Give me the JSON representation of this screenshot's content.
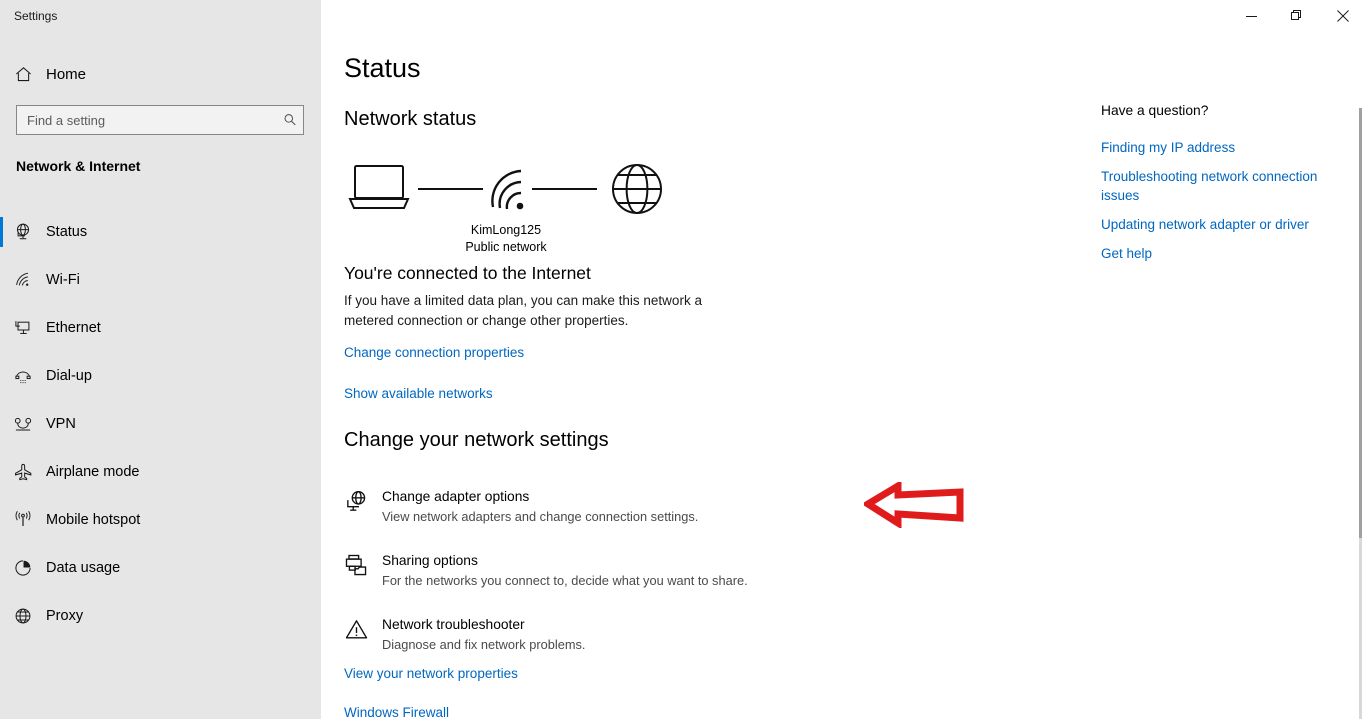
{
  "window": {
    "title": "Settings",
    "controls": [
      {
        "name": "minimize",
        "label": "Minimize"
      },
      {
        "name": "restore",
        "label": "Restore"
      },
      {
        "name": "close",
        "label": "Close"
      }
    ]
  },
  "sidebar": {
    "home_label": "Home",
    "home_icon": "home-icon",
    "search": {
      "placeholder": "Find a setting",
      "value": "",
      "icon": "search-icon"
    },
    "category": "Network & Internet",
    "items": [
      {
        "label": "Status",
        "icon": "status-globe-icon",
        "selected": true
      },
      {
        "label": "Wi-Fi",
        "icon": "wifi-icon",
        "selected": false
      },
      {
        "label": "Ethernet",
        "icon": "ethernet-icon",
        "selected": false
      },
      {
        "label": "Dial-up",
        "icon": "dialup-icon",
        "selected": false
      },
      {
        "label": "VPN",
        "icon": "vpn-icon",
        "selected": false
      },
      {
        "label": "Airplane mode",
        "icon": "airplane-icon",
        "selected": false
      },
      {
        "label": "Mobile hotspot",
        "icon": "hotspot-icon",
        "selected": false
      },
      {
        "label": "Data usage",
        "icon": "data-usage-icon",
        "selected": false
      },
      {
        "label": "Proxy",
        "icon": "proxy-globe-icon",
        "selected": false
      }
    ]
  },
  "main": {
    "page_title": "Status",
    "network_status_heading": "Network status",
    "diagram": {
      "device_icon": "laptop-icon",
      "connection_icon": "wifi-signal-icon",
      "internet_icon": "globe-icon",
      "network_name": "KimLong125",
      "network_type": "Public network"
    },
    "connected_title": "You're connected to the Internet",
    "connected_desc": "If you have a limited data plan, you can make this network a metered connection or change other properties.",
    "link_change_connection": "Change connection properties",
    "link_show_networks": "Show available networks",
    "change_settings_heading": "Change your network settings",
    "options": [
      {
        "title": "Change adapter options",
        "desc": "View network adapters and change connection settings.",
        "icon": "adapter-globe-monitor-icon"
      },
      {
        "title": "Sharing options",
        "desc": "For the networks you connect to, decide what you want to share.",
        "icon": "sharing-printer-folder-icon"
      },
      {
        "title": "Network troubleshooter",
        "desc": "Diagnose and fix network problems.",
        "icon": "warning-triangle-icon"
      }
    ],
    "link_view_properties": "View your network properties",
    "link_windows_firewall": "Windows Firewall"
  },
  "help": {
    "title": "Have a question?",
    "links": [
      "Finding my IP address",
      "Troubleshooting network connection issues",
      "Updating network adapter or driver",
      "Get help"
    ]
  },
  "annotation": {
    "type": "arrow",
    "direction": "left",
    "color": "#e01b1b",
    "points_at": "Change adapter options"
  },
  "colors": {
    "accent": "#0078d7",
    "link": "#0067c0",
    "sidebar_bg": "#e6e6e6",
    "main_bg": "#ffffff",
    "annotation_red": "#e01b1b"
  }
}
